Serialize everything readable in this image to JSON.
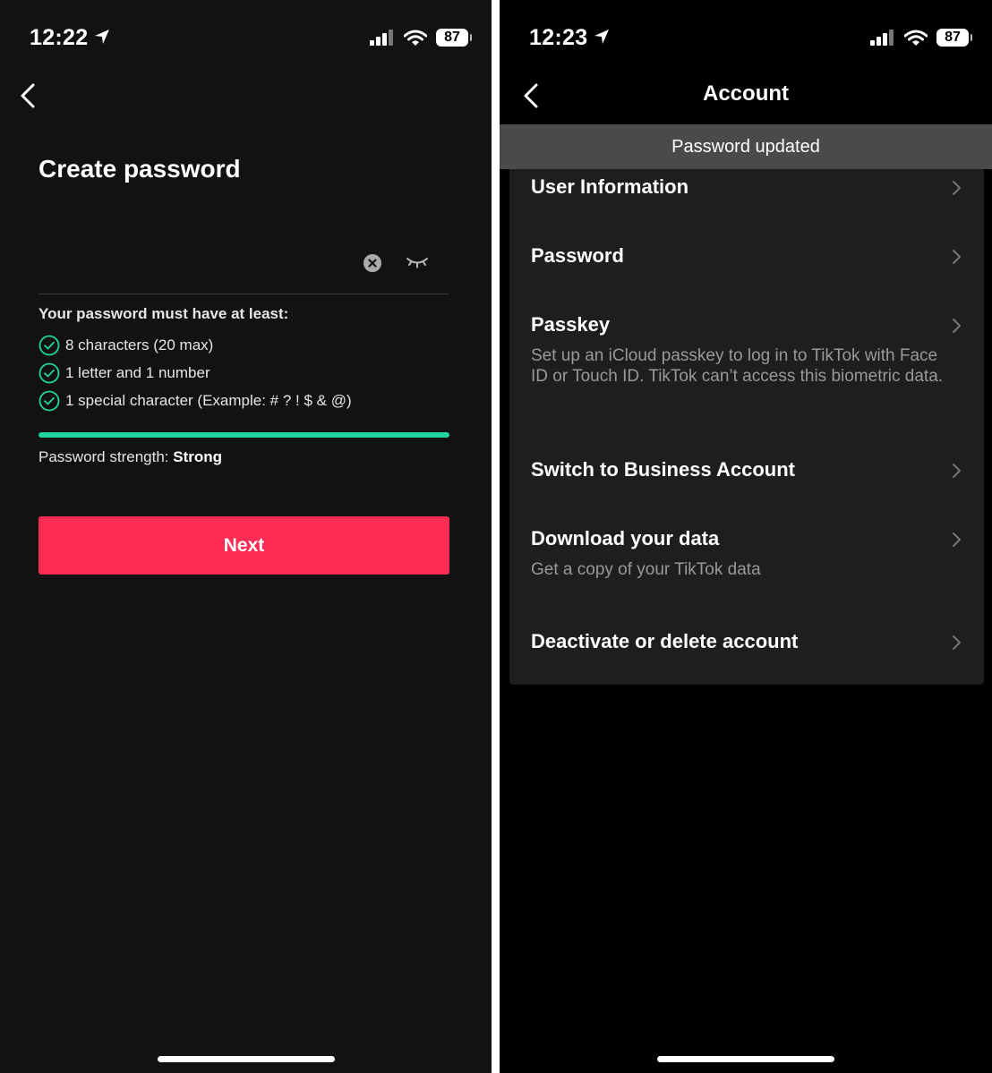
{
  "left": {
    "status": {
      "time": "12:22",
      "battery": "87"
    },
    "title": "Create password",
    "requirements_title": "Your password must have at least:",
    "requirements": [
      "8 characters (20 max)",
      "1 letter and 1 number",
      "1 special character (Example: # ? ! $ & @)"
    ],
    "strength_label": "Password strength: ",
    "strength_value": "Strong",
    "strength_fraction": 1.0,
    "next_label": "Next",
    "colors": {
      "accent": "#fe2c55",
      "success": "#20d5a0"
    }
  },
  "right": {
    "status": {
      "time": "12:23",
      "battery": "87"
    },
    "nav_title": "Account",
    "toast": "Password updated",
    "items": [
      {
        "label": "User Information"
      },
      {
        "label": "Password"
      },
      {
        "label": "Passkey",
        "sub": "Set up an iCloud passkey to log in to TikTok with Face ID or Touch ID. TikTok can’t access this biometric data."
      },
      {
        "label": "Switch to Business Account"
      },
      {
        "label": "Download your data",
        "sub": "Get a copy of your TikTok data"
      },
      {
        "label": "Deactivate or delete account"
      }
    ]
  }
}
